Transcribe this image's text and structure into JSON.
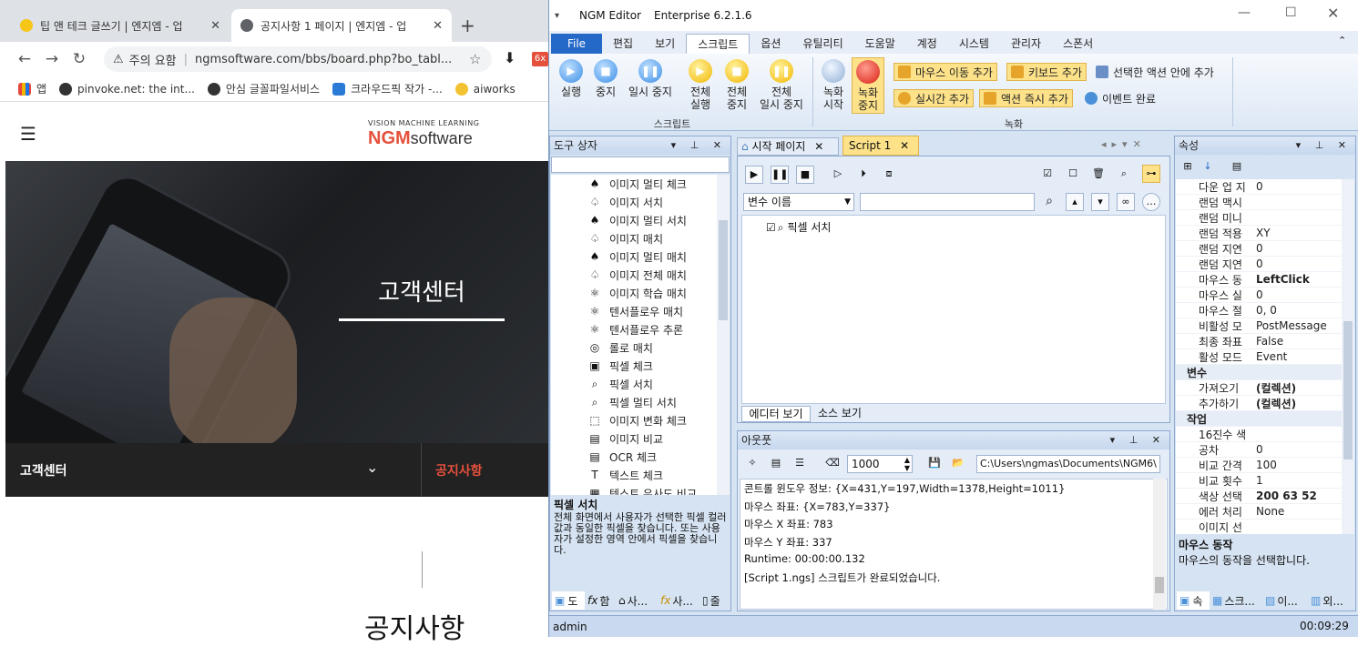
{
  "browser": {
    "tabs": [
      {
        "title": "팁 앤 테크 글쓰기 | 엔지엠 - 업",
        "close": "✕"
      },
      {
        "title": "공지사항 1 페이지 | 엔지엠 - 업",
        "close": "✕"
      }
    ],
    "new_tab": "+",
    "security_label": "주의 요함",
    "url": "ngmsoftware.com/bbs/board.php?bo_tabl...",
    "bookmarks": [
      "앱",
      "pinvoke.net: the int...",
      "안심 글꼴파일서비스",
      "크라우드픽 작가 -...",
      "aiworks"
    ],
    "ext_badge": "6x"
  },
  "website": {
    "logo_tagline": "VISION MACHINE LEARNING",
    "logo_main": "NGM",
    "logo_sub": "software",
    "hero_title": "고객센터",
    "subnav_left": "고객센터",
    "subnav_right": "공지사항",
    "page_title": "공지사항"
  },
  "editor": {
    "app_name": "NGM Editor",
    "edition": "Enterprise 6.2.1.6",
    "menu": [
      "File",
      "편집",
      "보기",
      "스크립트",
      "옵션",
      "유틸리티",
      "도움말",
      "계정",
      "시스템",
      "관리자",
      "스폰서"
    ],
    "ribbon": {
      "run": "실행",
      "stop": "중지",
      "pause": "일시 중지",
      "run_all_1": "전체",
      "run_all_2": "실행",
      "stop_all_1": "전체",
      "stop_all_2": "중지",
      "pause_all_1": "전체",
      "pause_all_2": "일시 중지",
      "rec_start_1": "녹화",
      "rec_start_2": "시작",
      "rec_stop_1": "녹화",
      "rec_stop_2": "중지",
      "add_mouse_move": "마우스 이동 추가",
      "add_keyboard": "키보드 추가",
      "add_in_selected": "선택한 액션 안에 추가",
      "add_realtime": "실시간 추가",
      "add_action_now": "액션 즉시 추가",
      "event_complete": "이벤트 완료",
      "group_script": "스크립트",
      "group_record": "녹화"
    },
    "toolbox": {
      "title": "도구 상자",
      "items": [
        "이미지 멀티 체크",
        "이미지 서치",
        "이미지 멀티 서치",
        "이미지 매치",
        "이미지 멀티 매치",
        "이미지 전체 매치",
        "이미지 학습 매치",
        "텐서플로우 매치",
        "텐서플로우 추론",
        "롤로 매치",
        "픽셀 체크",
        "픽셀 서치",
        "픽셀 멀티 서치",
        "이미지 변화 체크",
        "이미지 비교",
        "OCR 체크",
        "텍스트 체크",
        "텍스트 유사도 비교"
      ],
      "desc_title": "픽셀 서치",
      "desc_text": "전체 화면에서 사용자가 선택한 픽셀 컬러값과 동일한 픽셀을 찾습니다. 또는 사용자가 설정한 영역 안에서 픽셀을 찾습니다.",
      "bottom_tabs": [
        "도",
        "함",
        "사...",
        "사...",
        "줄"
      ]
    },
    "docs": {
      "tab_start": "시작 페이지",
      "tab_script": "Script 1",
      "var_combo": "변수 이름",
      "tree_item": "픽셀 서치",
      "view_editor": "에디터 보기",
      "view_source": "소스 보기"
    },
    "output": {
      "title": "아웃풋",
      "count": "1000",
      "path": "C:\\Users\\ngmas\\Documents\\NGM6\\",
      "lines": [
        "콘트롤 윈도우 정보: {X=431,Y=197,Width=1378,Height=1011}",
        "마우스 좌표: {X=783,Y=337}",
        "마우스 X 좌표: 783",
        "마우스 Y 좌표: 337",
        "Runtime: 00:00:00.132",
        "[Script 1.ngs] 스크립트가 완료되었습니다."
      ]
    },
    "properties": {
      "title": "속성",
      "rows": [
        {
          "name": "다운 업 지",
          "value": "0"
        },
        {
          "name": "랜덤 맥시",
          "value": ""
        },
        {
          "name": "랜덤 미니",
          "value": ""
        },
        {
          "name": "랜덤 적용",
          "value": "XY"
        },
        {
          "name": "랜덤 지연",
          "value": "0"
        },
        {
          "name": "랜덤 지연",
          "value": "0"
        },
        {
          "name": "마우스 동",
          "value": "LeftClick"
        },
        {
          "name": "마우스 실",
          "value": "0"
        },
        {
          "name": "마우스 절",
          "value": "0, 0"
        },
        {
          "name": "비활성 모",
          "value": "PostMessage"
        },
        {
          "name": "최종 좌표",
          "value": "False"
        },
        {
          "name": "활성 모드",
          "value": "Event"
        },
        {
          "name": "변수",
          "value": "",
          "category": true
        },
        {
          "name": "가져오기",
          "value": "(컬렉션)"
        },
        {
          "name": "추가하기",
          "value": "(컬렉션)"
        },
        {
          "name": "작업",
          "value": "",
          "category": true
        },
        {
          "name": "16진수 색",
          "value": ""
        },
        {
          "name": "공차",
          "value": "0"
        },
        {
          "name": "비교 간격",
          "value": "100"
        },
        {
          "name": "비교 횟수",
          "value": "1"
        },
        {
          "name": "색상 선택",
          "value": "200 63 52"
        },
        {
          "name": "에러 처리",
          "value": "None"
        },
        {
          "name": "이미지 선",
          "value": ""
        }
      ],
      "desc_title": "마우스 동작",
      "desc_text": "마우스의 동작을 선택합니다.",
      "bottom_tabs": [
        "속",
        "스크...",
        "이...",
        "외..."
      ]
    },
    "status": {
      "user": "admin",
      "time": "00:09:29"
    }
  },
  "colors": {
    "accent_red": "#e5503c",
    "ribbon_blue": "#2468c8"
  }
}
